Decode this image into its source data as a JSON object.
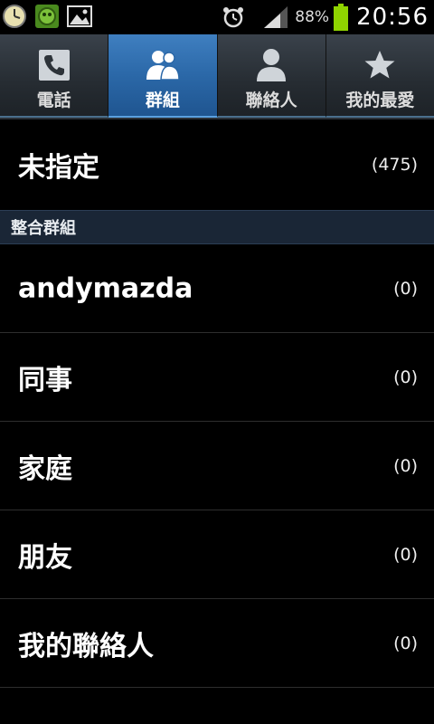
{
  "status_bar": {
    "battery_percent": "88%",
    "time": "20:56",
    "icons": [
      "clock-app-icon",
      "game-app-icon",
      "gallery-icon",
      "alarm-icon",
      "signal-icon",
      "battery-icon"
    ]
  },
  "tabs": [
    {
      "label": "電話",
      "icon": "phone-icon",
      "active": false
    },
    {
      "label": "群組",
      "icon": "group-icon",
      "active": true
    },
    {
      "label": "聯絡人",
      "icon": "contact-icon",
      "active": false
    },
    {
      "label": "我的最愛",
      "icon": "star-icon",
      "active": false
    }
  ],
  "unassigned": {
    "name": "未指定",
    "count": "(475)"
  },
  "section": {
    "label": "整合群組"
  },
  "groups": [
    {
      "name": "andymazda",
      "count": "(0)"
    },
    {
      "name": "同事",
      "count": "(0)"
    },
    {
      "name": "家庭",
      "count": "(0)"
    },
    {
      "name": "朋友",
      "count": "(0)"
    },
    {
      "name": "我的聯絡人",
      "count": "(0)"
    }
  ],
  "colors": {
    "active_tab": "#2b68a8",
    "section_bg": "#1a2636",
    "battery": "#8fd400"
  }
}
